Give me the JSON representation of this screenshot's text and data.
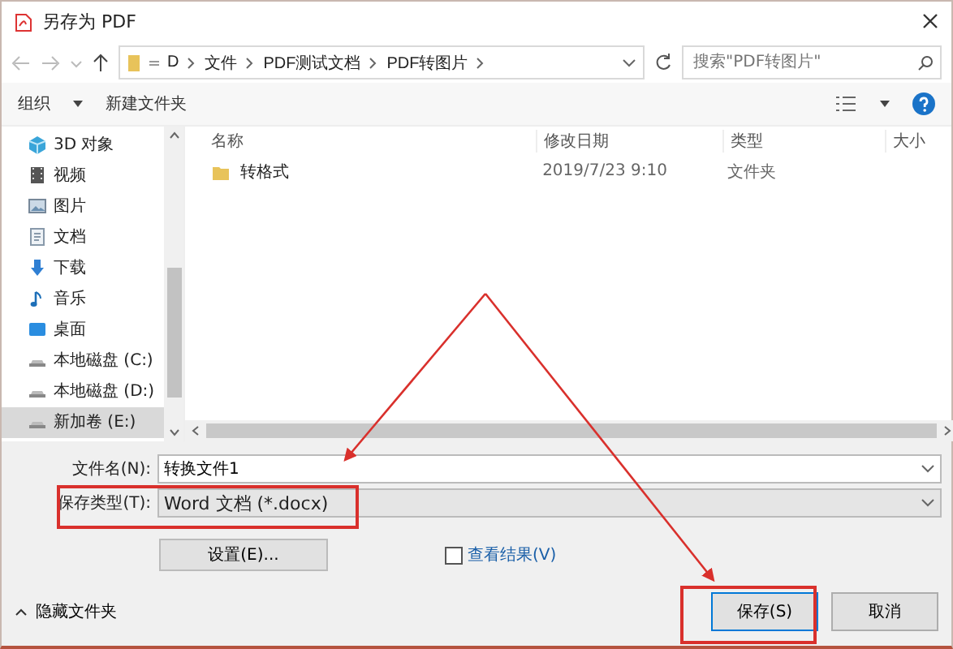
{
  "window": {
    "title": "另存为 PDF"
  },
  "nav": {
    "path": [
      "D",
      "文件",
      "PDF测试文档",
      "PDF转图片"
    ],
    "search_placeholder": "搜索\"PDF转图片\""
  },
  "toolbar": {
    "organize": "组织",
    "new_folder": "新建文件夹"
  },
  "sidebar": {
    "items": [
      {
        "label": "3D 对象",
        "kind": "cube",
        "selected": false
      },
      {
        "label": "视频",
        "kind": "video",
        "selected": false
      },
      {
        "label": "图片",
        "kind": "picture",
        "selected": false
      },
      {
        "label": "文档",
        "kind": "document",
        "selected": false
      },
      {
        "label": "下载",
        "kind": "download",
        "selected": false
      },
      {
        "label": "音乐",
        "kind": "music",
        "selected": false
      },
      {
        "label": "桌面",
        "kind": "desktop",
        "selected": false
      },
      {
        "label": "本地磁盘 (C:)",
        "kind": "drive",
        "selected": false
      },
      {
        "label": "本地磁盘 (D:)",
        "kind": "drive",
        "selected": false
      },
      {
        "label": "新加卷 (E:)",
        "kind": "drive",
        "selected": true
      }
    ]
  },
  "table": {
    "columns": [
      "名称",
      "修改日期",
      "类型",
      "大小"
    ],
    "rows": [
      {
        "name": "转格式",
        "modified": "2019/7/23 9:10",
        "type": "文件夹"
      }
    ]
  },
  "form": {
    "filename_label": "文件名(N):",
    "filename": "转换文件1",
    "type_label": "保存类型(T):",
    "type": "Word 文档 (*.docx)",
    "settings_button": "设置(E)...",
    "view_result": {
      "label": "查看结果(V)",
      "checked": false
    }
  },
  "footer": {
    "hide_folders": "隐藏文件夹",
    "buttons": [
      {
        "label": "保存(S)",
        "kind": "primary"
      },
      {
        "label": "取消",
        "kind": "normal"
      }
    ]
  }
}
